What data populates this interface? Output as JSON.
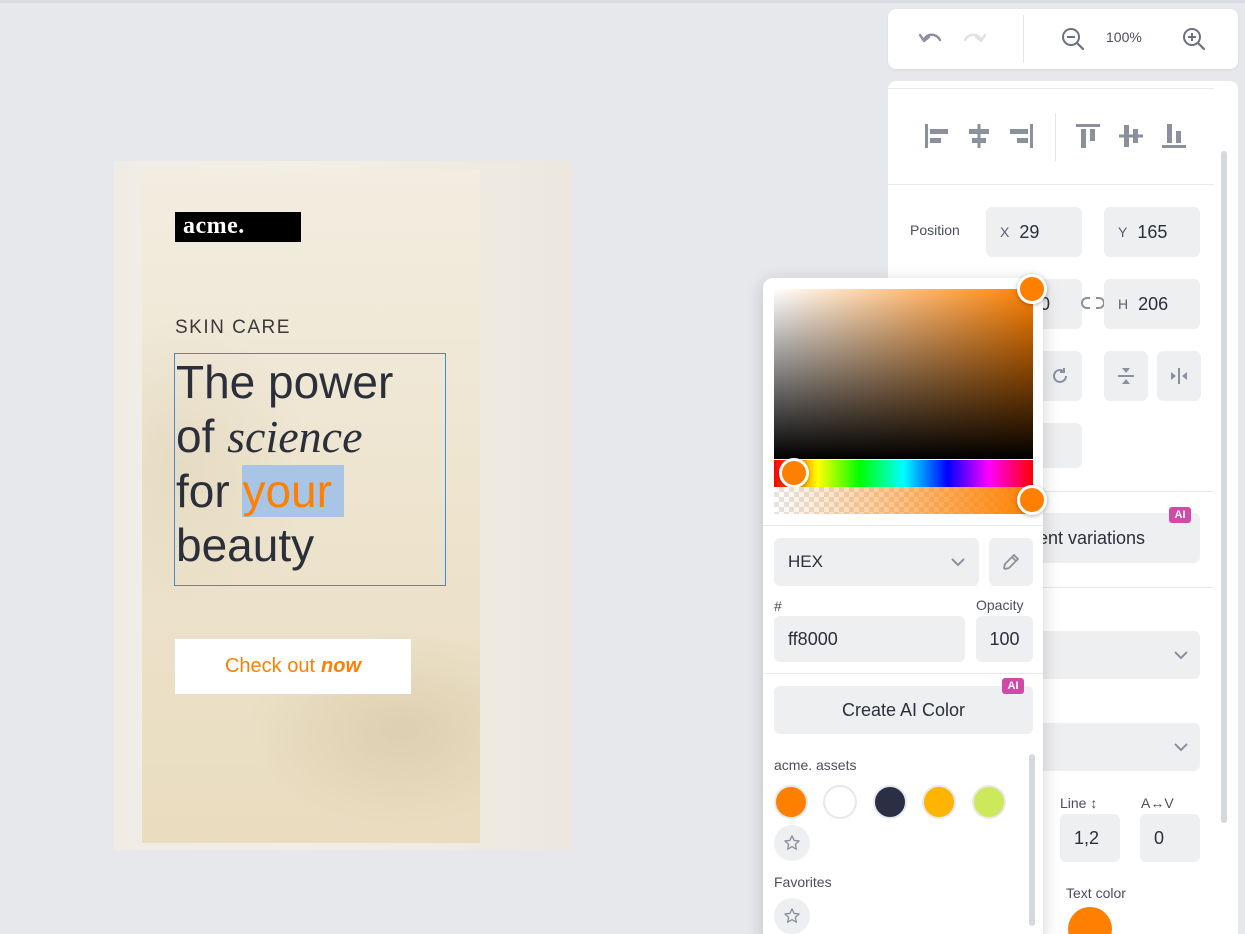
{
  "history": {
    "zoom_label": "100%"
  },
  "design": {
    "logo": "acme.",
    "eyebrow": "SKIN CARE",
    "headline": {
      "line1": "The power",
      "of": "of ",
      "science": "science",
      "for": "for ",
      "your": "your",
      "beauty": "beauty"
    },
    "cta": {
      "text": "Check out",
      "emph": "now"
    }
  },
  "panel": {
    "position_label": "Position",
    "x_key": "X",
    "x_value": "29",
    "y_key": "Y",
    "y_value": "165",
    "w_value": "0",
    "h_key": "H",
    "h_value": "206",
    "variations_label": "ent variations",
    "ai_badge": "AI",
    "line_label": "Line ↕",
    "line_value": "1,2",
    "av_label": "A↔V",
    "av_value": "0",
    "text_color_label": "Text color"
  },
  "picker": {
    "format": "HEX",
    "hex_label": "#",
    "hex_value": "ff8000",
    "opacity_label": "Opacity",
    "opacity_value": "100",
    "ai_button": "Create AI Color",
    "ai_badge": "AI",
    "assets_label": "acme. assets",
    "favorites_label": "Favorites",
    "swatches": [
      "#ff8000",
      "#ffffff",
      "#2b2f45",
      "#ffb400",
      "#cde85a"
    ]
  }
}
